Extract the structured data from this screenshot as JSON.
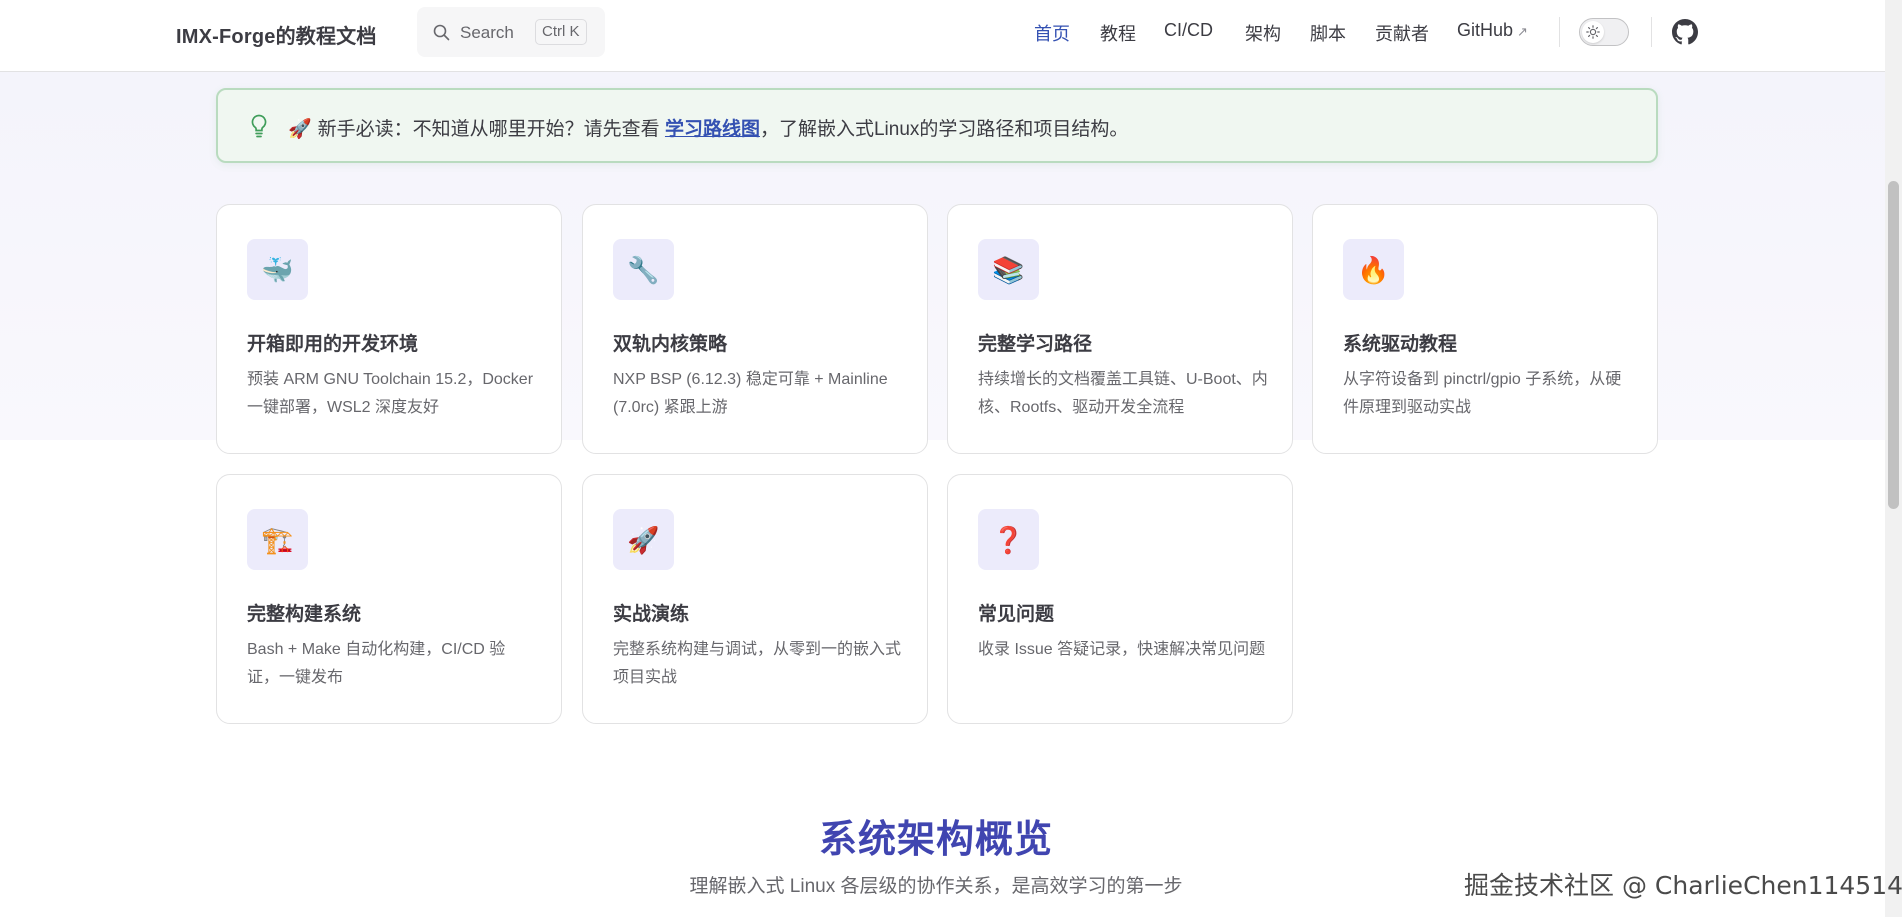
{
  "navbar": {
    "brand": "IMX-Forge的教程文档",
    "search": {
      "label": "Search",
      "kbd": "Ctrl K"
    },
    "links": [
      {
        "label": "首页",
        "active": true
      },
      {
        "label": "教程"
      },
      {
        "label": "CI/CD"
      },
      {
        "label": "架构"
      },
      {
        "label": "脚本"
      },
      {
        "label": "贡献者"
      },
      {
        "label": "GitHub",
        "external": true
      }
    ],
    "icons": {
      "theme": "sun-icon",
      "github": "github-icon",
      "external": "external-link-icon"
    }
  },
  "tip": {
    "icon": "lightbulb-icon",
    "emoji": "🚀",
    "prefix": "新手必读：不知道从哪里开始？请先查看",
    "link": "学习路线图",
    "suffix": "，了解嵌入式Linux的学习路径和项目结构。"
  },
  "features": [
    {
      "icon": "🐳",
      "title": "开箱即用的开发环境",
      "desc": "预装 ARM GNU Toolchain 15.2，Docker 一键部署，WSL2 深度友好"
    },
    {
      "icon": "🔧",
      "title": "双轨内核策略",
      "desc": "NXP BSP (6.12.3) 稳定可靠 + Mainline (7.0rc) 紧跟上游"
    },
    {
      "icon": "📚",
      "title": "完整学习路径",
      "desc": "持续增长的文档覆盖工具链、U-Boot、内核、Rootfs、驱动开发全流程"
    },
    {
      "icon": "🔥",
      "title": "系统驱动教程",
      "desc": "从字符设备到 pinctrl/gpio 子系统，从硬件原理到驱动实战"
    },
    {
      "icon": "🏗️",
      "title": "完整构建系统",
      "desc": "Bash + Make 自动化构建，CI/CD 验证，一键发布"
    },
    {
      "icon": "🚀",
      "title": "实战演练",
      "desc": "完整系统构建与调试，从零到一的嵌入式项目实战"
    },
    {
      "icon": "❓",
      "title": "常见问题",
      "desc": "收录 Issue 答疑记录，快速解决常见问题"
    }
  ],
  "section": {
    "title": "系统架构概览",
    "subtitle": "理解嵌入式 Linux 各层级的协作关系，是高效学习的第一步"
  },
  "watermark": "掘金技术社区 @ CharlieChen114514",
  "colors": {
    "accent": "#3451b2",
    "section_title": "#4045b0",
    "tip_border": "#b9dbbf",
    "icon_bg": "#ecebfb"
  }
}
